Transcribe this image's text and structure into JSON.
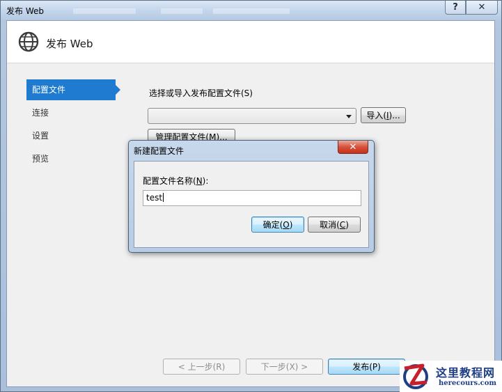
{
  "window": {
    "title": "发布 Web",
    "help_label": "?",
    "close_label": "✕"
  },
  "header": {
    "title": "发布 Web",
    "icon": "globe-icon"
  },
  "nav": {
    "items": [
      {
        "label": "配置文件",
        "active": true
      },
      {
        "label": "连接",
        "active": false
      },
      {
        "label": "设置",
        "active": false
      },
      {
        "label": "预览",
        "active": false
      }
    ]
  },
  "profile": {
    "section_label": "选择或导入发布配置文件(S)",
    "combo_value": "",
    "import_button": {
      "pre": "导入(",
      "key": "I",
      "post": ")..."
    },
    "manage_button": {
      "pre": "管理配置文件(",
      "key": "M",
      "post": ")..."
    }
  },
  "dialog": {
    "title": "新建配置文件",
    "close_label": "✕",
    "name_label": {
      "pre": "配置文件名称(",
      "key": "N",
      "post": "):"
    },
    "name_value": "test",
    "ok_button": {
      "pre": "确定(",
      "key": "O",
      "post": ")"
    },
    "cancel_button": {
      "pre": "取消(",
      "key": "C",
      "post": ")"
    }
  },
  "footer": {
    "prev_button": "< 上一步(R)",
    "next_button": "下一步(X) >",
    "publish_button": "发布(P)"
  },
  "watermark": {
    "line1": "这里教程网",
    "line2": "herecours.com"
  },
  "colors": {
    "accent": "#1e7bd0",
    "titlebar": "#c4d6ec",
    "dialog_close": "#d7523c",
    "watermark": "#1e3f86"
  }
}
